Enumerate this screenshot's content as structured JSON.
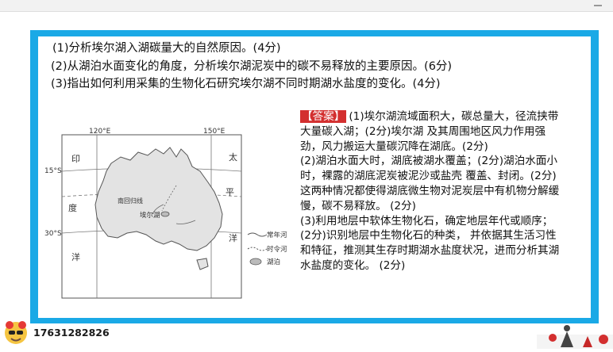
{
  "questions": {
    "q1": "(1)分析埃尔湖入湖碳量大的自然原因。(4分)",
    "q2": "(2)从湖泊水面变化的角度，分析埃尔湖泥炭中的碳不易释放的主要原因。(6分)",
    "q3": "(3)指出如何利用采集的生物化石研究埃尔湖不同时期湖水盐度的变化。(4分)"
  },
  "map": {
    "lon_labels": [
      "120°E",
      "150°E"
    ],
    "lat_labels": [
      "15°S",
      "30°S"
    ],
    "ocean_left": [
      "印",
      "度",
      "洋"
    ],
    "ocean_right": [
      "太",
      "平",
      "洋"
    ],
    "tropic_label": "南回归线",
    "lake_label": "埃尔湖",
    "legend": {
      "perennial": "常年河",
      "seasonal": "时令河",
      "lake": "湖泊"
    }
  },
  "answer": {
    "tag": "【答案】",
    "p1": "(1)埃尔湖流域面积大，碳总量大，径流挟带大量碳入湖；(2分)埃尔湖 及其周围地区风力作用强劲，风力搬运大量碳沉降在湖底。(2分)",
    "p2": "(2)湖泊水面大时，湖底被湖水覆盖；(2分)湖泊水面小时，裸露的湖底泥炭被泥沙或盐壳 覆盖、封闭。(2分)这两种情况都使得湖底微生物对泥炭层中有机物分解缓慢，碳不易释放。 (2分)",
    "p3": "(3)利用地层中软体生物化石，确定地层年代或顺序；(2分)识别地层中生物化石的种类， 并依据其生活习性和特征，推测其生存时期湖水盐度状况，进而分析其湖水盐度的变化。 (2分)"
  },
  "footer": {
    "phone": "17631282826"
  },
  "colors": {
    "frame": "#1aa9e6",
    "tag_bg": "#d32f2f"
  }
}
